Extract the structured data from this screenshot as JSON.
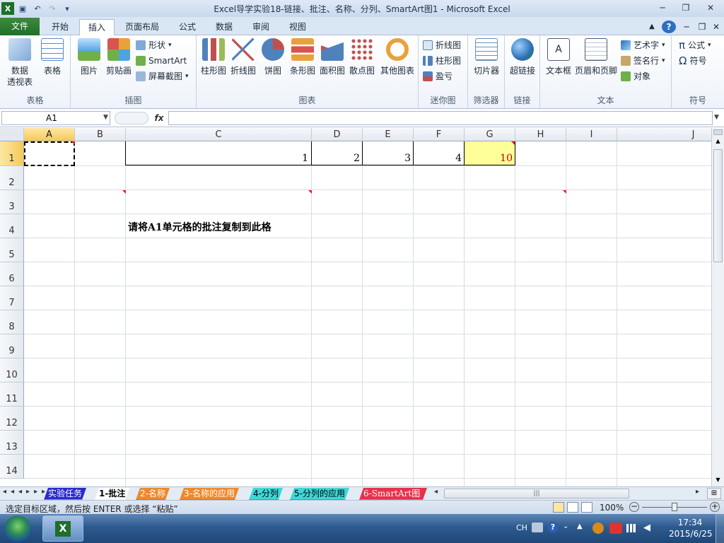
{
  "window": {
    "title": "Excel导学实验18-链接、批注、名称、分列、SmartArt图1  -  Microsoft Excel"
  },
  "tabs": [
    {
      "label": "文件"
    },
    {
      "label": "开始"
    },
    {
      "label": "插入"
    },
    {
      "label": "页面布局"
    },
    {
      "label": "公式"
    },
    {
      "label": "数据"
    },
    {
      "label": "审阅"
    },
    {
      "label": "视图"
    }
  ],
  "ribbon": {
    "groups": {
      "tables": "表格",
      "illustrations": "插图",
      "charts": "图表",
      "sparklines": "迷你图",
      "filter": "筛选器",
      "links": "链接",
      "text": "文本",
      "symbols": "符号"
    },
    "pivot_l1": "数据",
    "pivot_l2": "透视表",
    "table": "表格",
    "picture": "图片",
    "clipart": "剪贴画",
    "shapes": "形状",
    "smartart": "SmartArt",
    "screenshot": "屏幕截图",
    "column_chart": "柱形图",
    "line_chart": "折线图",
    "pie_chart": "饼图",
    "bar_chart": "条形图",
    "area_chart": "面积图",
    "scatter_chart": "散点图",
    "other_charts": "其他图表",
    "spark_line": "折线图",
    "spark_column": "柱形图",
    "spark_winloss": "盈亏",
    "slicer": "切片器",
    "hyperlink": "超链接",
    "textbox": "文本框",
    "header_footer": "页眉和页脚",
    "wordart": "艺术字",
    "signature": "签名行",
    "object": "对象",
    "equation": "公式",
    "symbol": "符号"
  },
  "formula_bar": {
    "name_box": "A1",
    "fx": "fx",
    "content": ""
  },
  "columns": [
    "A",
    "B",
    "C",
    "D",
    "E",
    "F",
    "G",
    "H",
    "I",
    "J"
  ],
  "rows": [
    "1",
    "2",
    "3",
    "4",
    "5",
    "6",
    "7",
    "8",
    "9",
    "10",
    "11",
    "12",
    "13",
    "14"
  ],
  "cells": {
    "C1": "1",
    "D1": "2",
    "E1": "3",
    "F1": "4",
    "G1": "10",
    "C4": "请将A1单元格的批注复制到此格"
  },
  "sheets": [
    "实验任务",
    "1-批注",
    "2-名称",
    "3-名称的应用",
    "4-分列",
    "5-分列的应用",
    "6-SmartArt图"
  ],
  "status": {
    "message": "选定目标区域，然后按 ENTER 或选择 “粘贴”",
    "zoom": "100%"
  },
  "taskbar": {
    "lang": "CH",
    "time": "17:34",
    "date": "2015/6/25"
  },
  "colors": {
    "accent_green": "#1f6e2a",
    "selected_header": "#f6c957",
    "highlight_cell": "#ffff99",
    "comment_marker": "#e21f1f",
    "value_red": "#c00000"
  }
}
